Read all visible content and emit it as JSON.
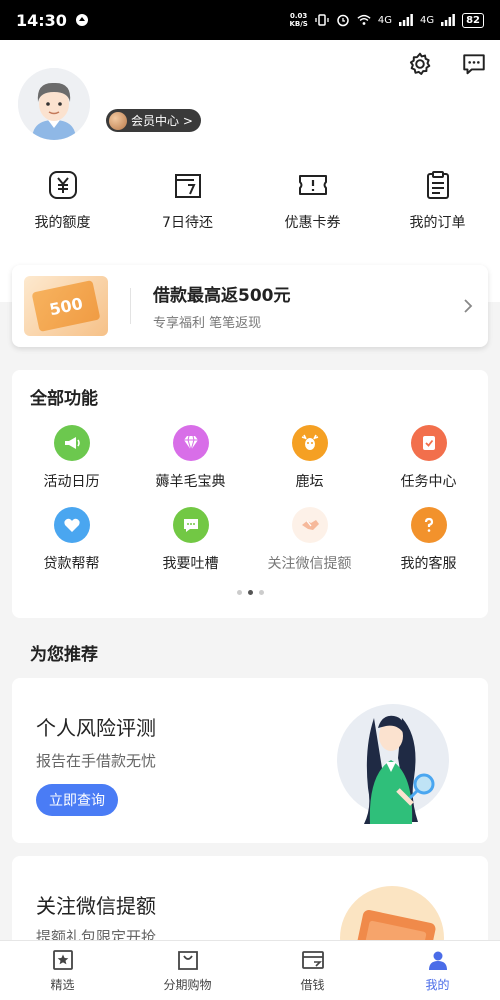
{
  "status_bar": {
    "time": "14:30",
    "speed_top": "0.03",
    "speed_bottom": "KB/S",
    "network_1": "4G",
    "network_2": "4G",
    "battery": "82"
  },
  "header": {
    "vip_label": "会员中心 >",
    "quick_actions": [
      {
        "label": "我的额度",
        "icon": "yuan-card-icon"
      },
      {
        "label": "7日待还",
        "icon": "calendar-7-icon"
      },
      {
        "label": "优惠卡券",
        "icon": "ticket-icon"
      },
      {
        "label": "我的订单",
        "icon": "clipboard-icon"
      }
    ]
  },
  "promo": {
    "ticket_text": "500",
    "title": "借款最高返500元",
    "subtitle": "专享福利 笔笔返现"
  },
  "features": {
    "title": "全部功能",
    "items": [
      {
        "label": "活动日历",
        "icon": "megaphone-icon",
        "color": "#6cc84e"
      },
      {
        "label": "薅羊毛宝典",
        "icon": "diamond-icon",
        "color": "#d86ee8"
      },
      {
        "label": "鹿坛",
        "icon": "deer-icon",
        "color": "#f5a023"
      },
      {
        "label": "任务中心",
        "icon": "task-icon",
        "color": "#f26f4c"
      },
      {
        "label": "贷款帮帮",
        "icon": "heart-icon",
        "color": "#4aa6f0"
      },
      {
        "label": "我要吐槽",
        "icon": "chat-icon",
        "color": "#72c844"
      },
      {
        "label": "关注微信提额",
        "icon": "handshake-icon",
        "color": "#f8dcc8"
      },
      {
        "label": "我的客服",
        "icon": "question-icon",
        "color": "#f2922c"
      }
    ]
  },
  "recommend": {
    "title": "为您推荐",
    "card1": {
      "title": "个人风险评测",
      "subtitle": "报告在手借款无忧",
      "button": "立即查询"
    },
    "card2": {
      "title": "关注微信提额",
      "subtitle": "提额礼包限定开抢"
    }
  },
  "tabbar": [
    {
      "label": "精选",
      "icon": "star-box-icon"
    },
    {
      "label": "分期购物",
      "icon": "shopping-bag-icon"
    },
    {
      "label": "借钱",
      "icon": "wallet-card-icon"
    },
    {
      "label": "我的",
      "icon": "person-icon"
    }
  ],
  "colors": {
    "accent": "#4a7cf5",
    "tab_active": "#4a6ce8"
  }
}
